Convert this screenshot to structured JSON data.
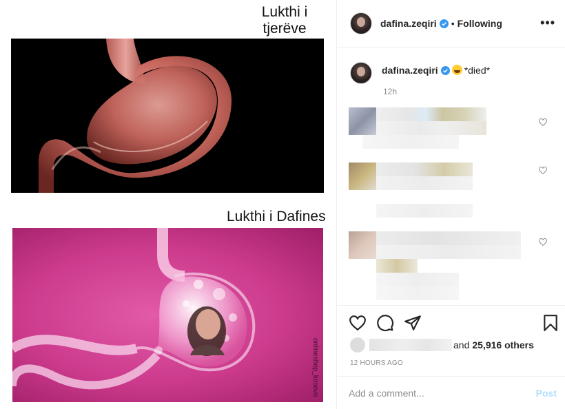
{
  "post": {
    "caption_top": "Lukthi i tjerëve",
    "caption_bottom": "Lukthi i Dafines",
    "watermark": "onlineshop_kosovo"
  },
  "header": {
    "username": "dafina.zeqiri",
    "separator": "•",
    "follow_status": "Following",
    "more_label": "•••"
  },
  "caption": {
    "username": "dafina.zeqiri",
    "emoji": "crying-face-emoji",
    "text": "*died*",
    "time": "12h"
  },
  "likes": {
    "text_and": "and",
    "count": "25,916 others",
    "posted": "12 HOURS AGO"
  },
  "comment_box": {
    "placeholder": "Add a comment...",
    "post_label": "Post"
  },
  "colors": {
    "verified_blue": "#3897f0",
    "post_button": "#b2dffc",
    "muted_text": "#8e8e8e",
    "panel_pink": "#cc3a8c"
  }
}
